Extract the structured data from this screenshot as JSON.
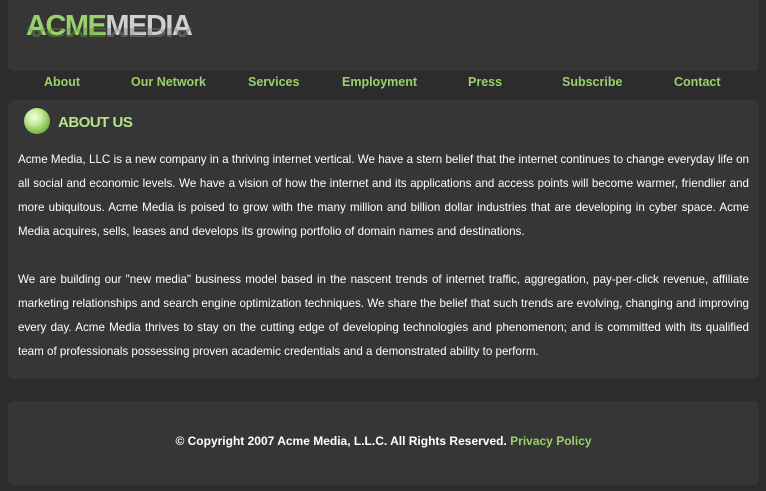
{
  "logo": {
    "part1": "ACME",
    "part2": "MEDIA"
  },
  "nav": [
    "About",
    "Our Network",
    "Services",
    "Employment",
    "Press",
    "Subscribe",
    "Contact"
  ],
  "about": {
    "title": "ABOUT US",
    "paragraphs": [
      "Acme Media, LLC is a new company in a thriving internet vertical. We have a stern belief that the internet continues to change everyday life on all social and economic levels. We have a vision of how the internet and its applications and access points will become warmer, friendlier and more ubiquitous. Acme Media is poised to grow with the many million and billion dollar industries that are developing in cyber space. Acme Media acquires, sells, leases and develops its growing portfolio of domain names and destinations.",
      "We are building our \"new media\" business model based in the nascent trends of internet traffic, aggregation, pay-per-click revenue, affiliate marketing relationships and search engine optimization techniques. We share the belief that such trends are evolving, changing and improving every day. Acme Media thrives to stay on the cutting edge of developing technologies and phenomenon; and is committed with its qualified team of professionals possessing proven academic credentials and a demonstrated ability to perform."
    ]
  },
  "footer": {
    "copyright": "© Copyright 2007 Acme Media, L.L.C. All Rights Reserved.",
    "privacy": "Privacy Policy"
  },
  "colors": {
    "accent": "#9ad16a",
    "background": "#2c2c2c",
    "panel": "#363636"
  }
}
